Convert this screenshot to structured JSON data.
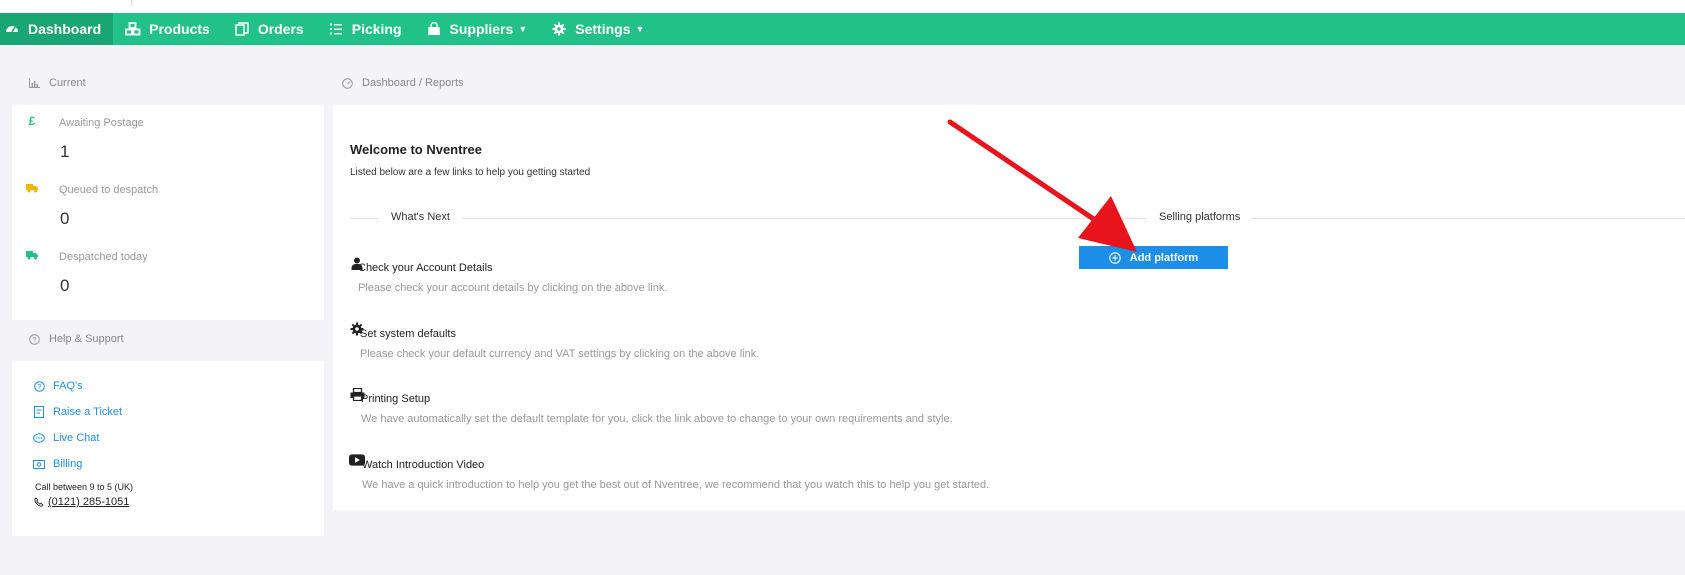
{
  "nav": {
    "items": [
      {
        "label": "Dashboard",
        "icon": "dashboard-icon"
      },
      {
        "label": "Products",
        "icon": "cubes-icon"
      },
      {
        "label": "Orders",
        "icon": "orders-icon"
      },
      {
        "label": "Picking",
        "icon": "list-icon"
      },
      {
        "label": "Suppliers",
        "icon": "shopping-bag-icon",
        "dropdown": true
      },
      {
        "label": "Settings",
        "icon": "gear-icon",
        "dropdown": true
      }
    ],
    "active": "Dashboard",
    "color": "#22c18a"
  },
  "current": {
    "heading": "Current",
    "stats": [
      {
        "label": "Awaiting Postage",
        "value": "1",
        "icon": "pound-icon",
        "icon_color": "#22c18a"
      },
      {
        "label": "Queued to despatch",
        "value": "0",
        "icon": "truck-icon",
        "icon_color": "#f5b400"
      },
      {
        "label": "Despatched today",
        "value": "0",
        "icon": "truck-icon",
        "icon_color": "#22c18a"
      }
    ]
  },
  "help": {
    "heading": "Help & Support",
    "links": [
      {
        "label": "FAQ's",
        "icon": "question-circle-icon"
      },
      {
        "label": "Raise a Ticket",
        "icon": "ticket-icon"
      },
      {
        "label": "Live Chat",
        "icon": "chat-icon"
      },
      {
        "label": "Billing",
        "icon": "billing-icon"
      }
    ],
    "call_text": "Call between 9 to 5 (UK)",
    "phone": "(0121) 285-1051",
    "link_color": "#1d8fe8"
  },
  "breadcrumb": "Dashboard / Reports",
  "main": {
    "title": "Welcome to Nventree",
    "subtitle": "Listed below are a few links to help you getting started",
    "whats_next": "What's Next",
    "selling_platforms": "Selling platforms",
    "add_platform": "Add platform",
    "tasks": [
      {
        "title": "Check your Account Details",
        "desc": "Please check your account details by clicking on the above link.",
        "icon": "user-icon"
      },
      {
        "title": "Set system defaults",
        "desc": "Please check your default currency and VAT settings by clicking on the above link.",
        "icon": "gear-icon"
      },
      {
        "title": "Printing Setup",
        "desc": "We have automatically set the default template for you, click the link above to change to your own requirements and style.",
        "icon": "printer-icon"
      },
      {
        "title": "Watch Introduction Video",
        "desc": "We have a quick introduction to help you get the best out of Nventree, we recommend that you watch this to help you get started.",
        "icon": "youtube-icon"
      }
    ]
  },
  "accent_blue": "#1d8fe8",
  "arrow_color": "#e8141b"
}
